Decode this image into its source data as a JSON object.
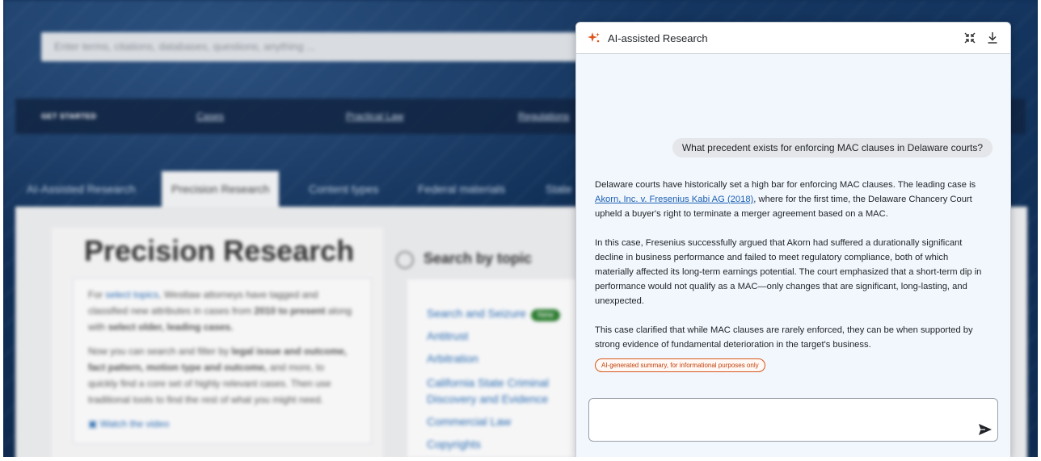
{
  "background": {
    "search_placeholder": "Enter terms, citations, databases, questions, anything ...",
    "nav": {
      "get_started": "GET STARTED",
      "links": [
        "Cases",
        "Practical Law",
        "Regulations"
      ]
    },
    "tabs": [
      "AI-Assisted Research",
      "Precision Research",
      "Content types",
      "Federal materials",
      "State"
    ],
    "active_tab": "Precision Research",
    "heading": "Precision Research",
    "intro": {
      "p1_a": "For ",
      "p1_link": "select topics",
      "p1_b": ", Westlaw attorneys have tagged and classified new attributes in cases from ",
      "p1_bold": "2010 to present",
      "p1_c": " along with ",
      "p1_bold2": "select older, leading cases.",
      "p2_a": "Now you can search and filter by ",
      "p2_bold": "legal issue and outcome, fact pattern, motion type and outcome,",
      "p2_b": " and more, to quickly find a core set of highly relevant cases. Then use traditional tools to find the rest of what you might need.",
      "video_link": "Watch the video"
    },
    "search_by_topic": "Search by topic",
    "topics": [
      "Search and Seizure",
      "Antitrust",
      "Arbitration",
      "California State Criminal Discovery and Evidence",
      "Commercial Law",
      "Copyrights"
    ],
    "new_badge": "New"
  },
  "panel": {
    "title": "AI-assisted Research",
    "icons": {
      "logo": "sparkle-icon",
      "expand": "collapse-icon",
      "download": "download-icon",
      "send": "send-icon"
    },
    "user_question": "What precedent exists for enforcing MAC clauses in Delaware courts?",
    "answer": {
      "p1_a": "Delaware courts have historically set a high bar for enforcing MAC clauses. The leading case is ",
      "p1_link": "Akorn, Inc. v. Fresenius Kabi AG (2018)",
      "p1_b": ", where for the first time, the Delaware Chancery Court upheld a buyer's right to terminate a merger agreement based on a MAC.",
      "p2": "In this case, Fresenius successfully argued that Akorn had suffered a durationally significant decline in business performance and failed to meet regulatory compliance, both of which materially affected its long-term earnings potential. The court emphasized that a short-term dip in performance would not qualify as a MAC—only changes that are significant, long-lasting, and unexpected.",
      "p3": "This case clarified that while MAC clauses are rarely enforced, they can be when supported by strong evidence of fundamental deterioration in the target's business."
    },
    "ai_badge": "AI-generated summary, for informational purposes only",
    "input_value": "",
    "accent_color": "#d6561b"
  }
}
